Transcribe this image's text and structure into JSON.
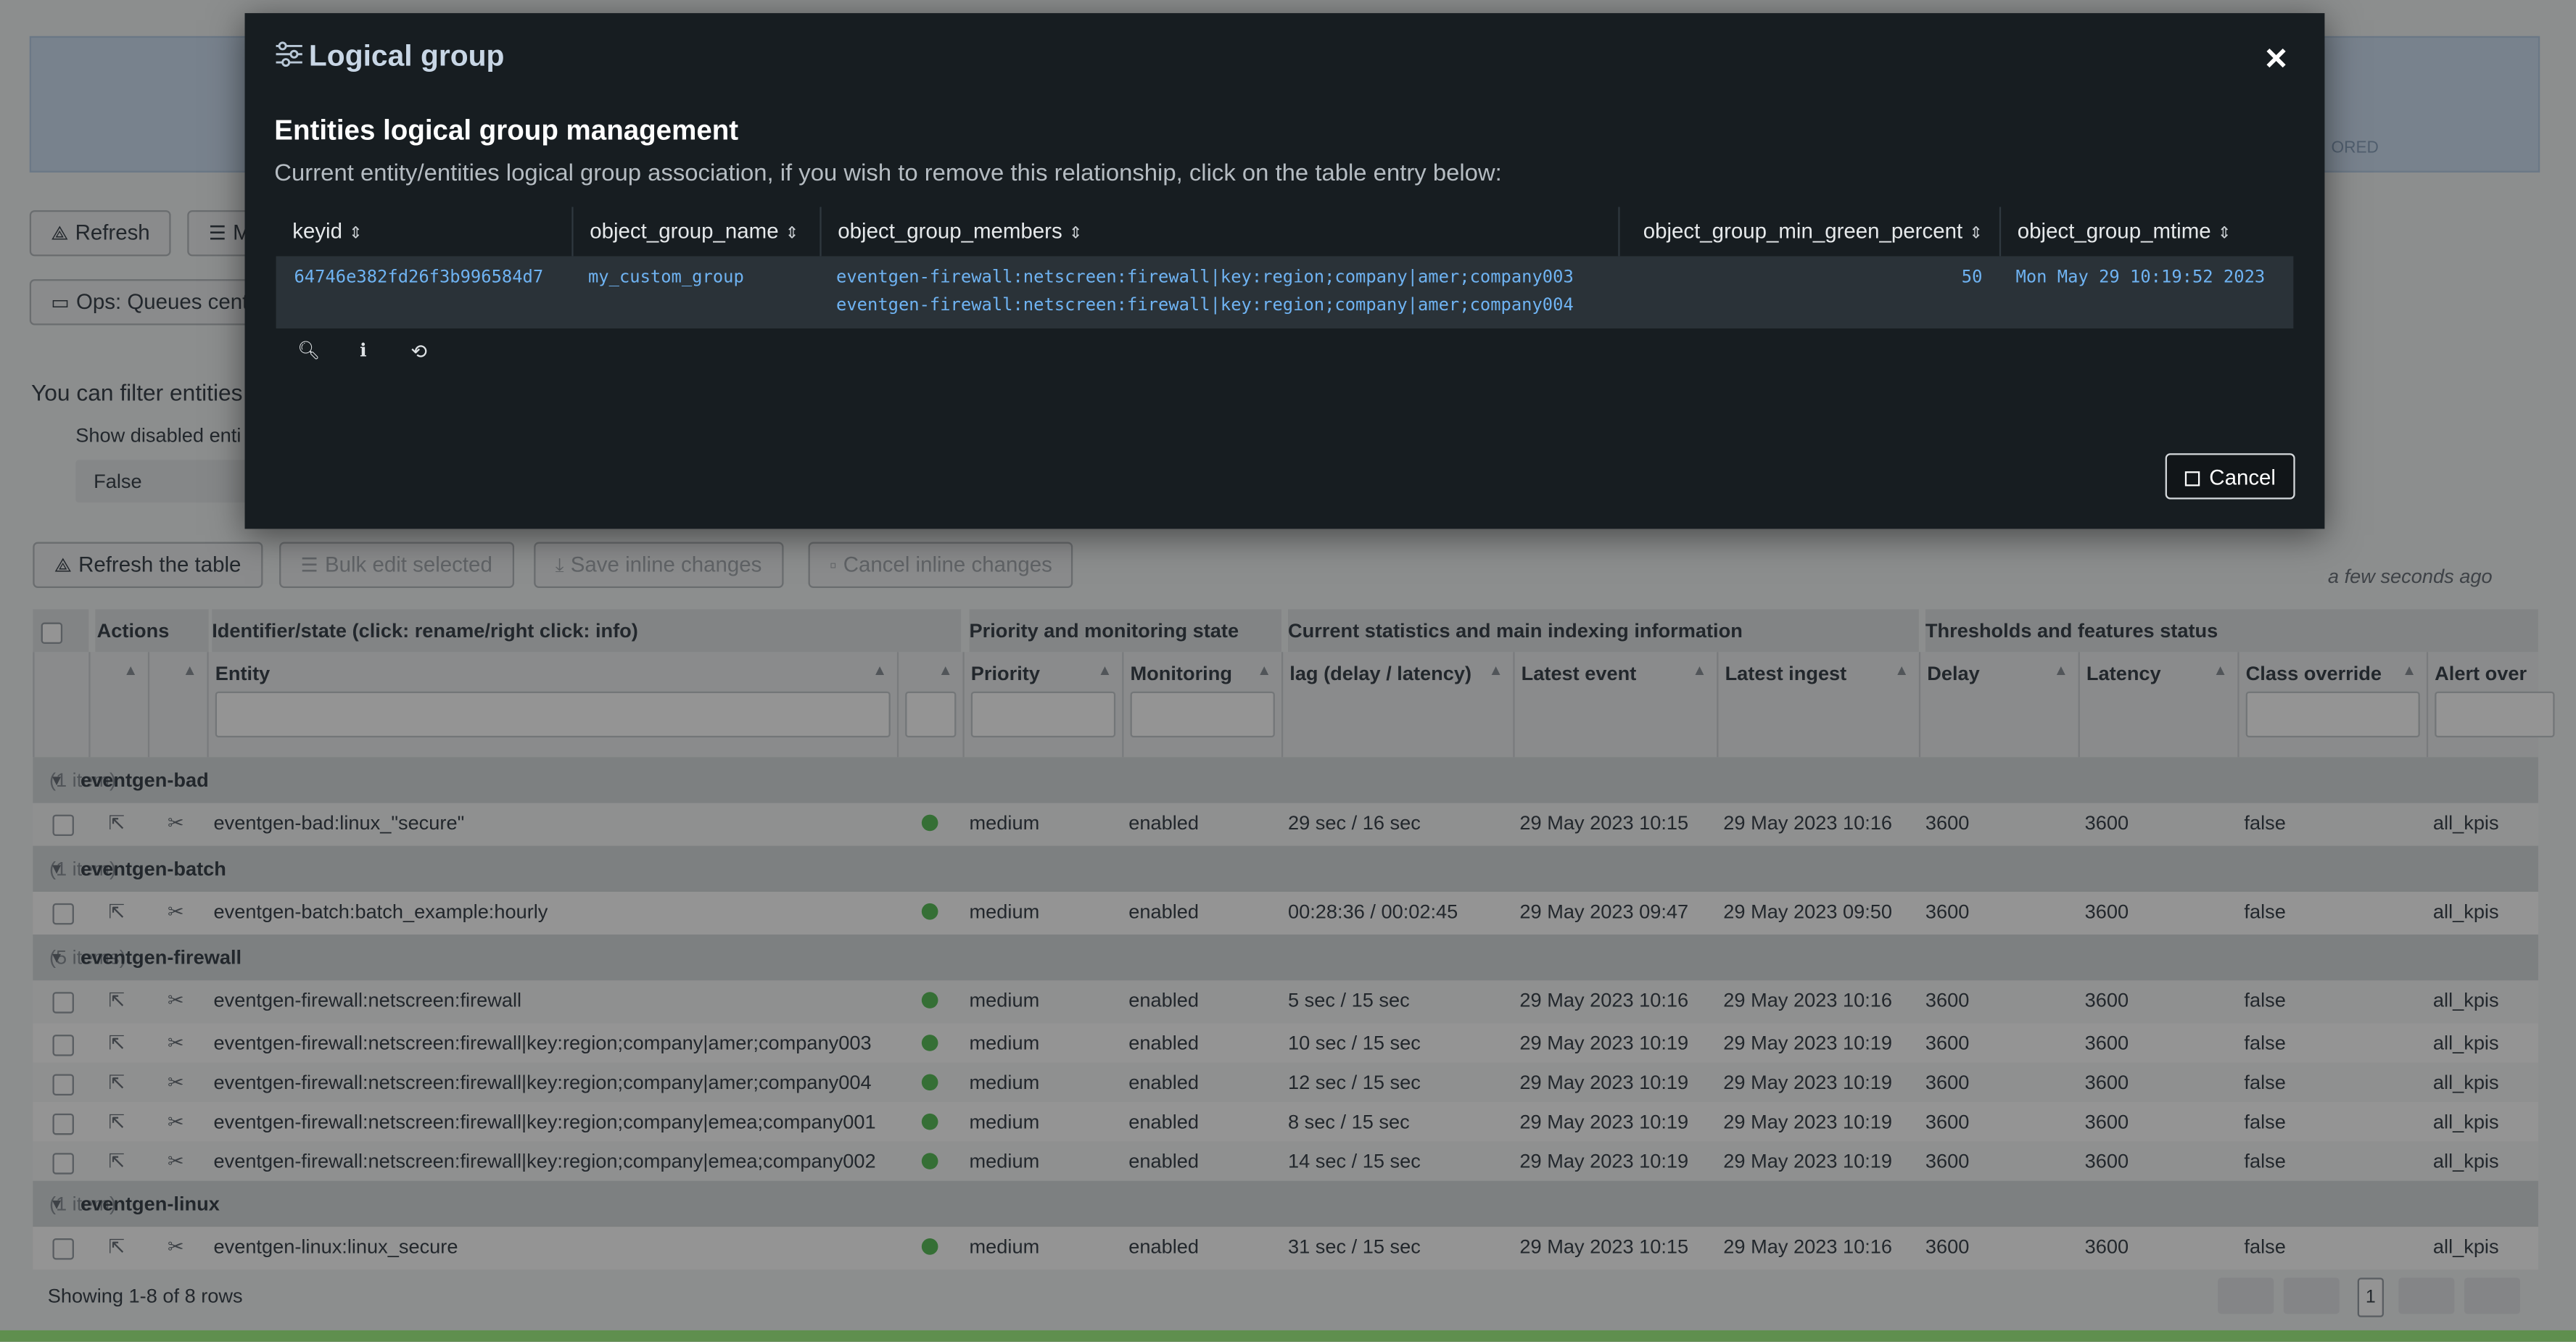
{
  "background": {
    "banner_fragment": "ORED",
    "refresh_label": "Refresh",
    "second_button_fragment": "M",
    "ops_button": "Ops: Queues cente",
    "filter_text": "You can filter entities",
    "show_disabled_label": "Show disabled enti",
    "show_disabled_value": "False",
    "toolbar": {
      "refresh_table": "Refresh the table",
      "bulk_edit": "Bulk edit selected",
      "save_inline": "Save inline changes",
      "cancel_inline": "Cancel inline changes",
      "updated": "a few seconds ago"
    },
    "table": {
      "group_headers": [
        "Actions",
        "Identifier/state (click: rename/right click: info)",
        "Priority and monitoring state",
        "Current statistics and main indexing information",
        "Thresholds and features status"
      ],
      "columns": [
        "Entity",
        "Priority",
        "Monitoring",
        "lag (delay / latency)",
        "Latest event",
        "Latest ingest",
        "Delay",
        "Latency",
        "Class override",
        "Alert over"
      ],
      "groups": [
        {
          "name": "eventgen-bad",
          "count": "(1 item)",
          "rows": [
            {
              "entity": "eventgen-bad:linux_\"secure\"",
              "priority": "medium",
              "monitoring": "enabled",
              "lag": "29 sec / 16 sec",
              "latest_event": "29 May 2023 10:15",
              "latest_ingest": "29 May 2023 10:16",
              "delay": "3600",
              "latency": "3600",
              "class_override": "false",
              "alert": "all_kpis"
            }
          ]
        },
        {
          "name": "eventgen-batch",
          "count": "(1 item)",
          "rows": [
            {
              "entity": "eventgen-batch:batch_example:hourly",
              "priority": "medium",
              "monitoring": "enabled",
              "lag": "00:28:36 / 00:02:45",
              "latest_event": "29 May 2023 09:47",
              "latest_ingest": "29 May 2023 09:50",
              "delay": "3600",
              "latency": "3600",
              "class_override": "false",
              "alert": "all_kpis"
            }
          ]
        },
        {
          "name": "eventgen-firewall",
          "count": "(5 items)",
          "rows": [
            {
              "entity": "eventgen-firewall:netscreen:firewall",
              "priority": "medium",
              "monitoring": "enabled",
              "lag": "5 sec / 15 sec",
              "latest_event": "29 May 2023 10:16",
              "latest_ingest": "29 May 2023 10:16",
              "delay": "3600",
              "latency": "3600",
              "class_override": "false",
              "alert": "all_kpis"
            },
            {
              "entity": "eventgen-firewall:netscreen:firewall|key:region;company|amer;company003",
              "priority": "medium",
              "monitoring": "enabled",
              "lag": "10 sec / 15 sec",
              "latest_event": "29 May 2023 10:19",
              "latest_ingest": "29 May 2023 10:19",
              "delay": "3600",
              "latency": "3600",
              "class_override": "false",
              "alert": "all_kpis"
            },
            {
              "entity": "eventgen-firewall:netscreen:firewall|key:region;company|amer;company004",
              "priority": "medium",
              "monitoring": "enabled",
              "lag": "12 sec / 15 sec",
              "latest_event": "29 May 2023 10:19",
              "latest_ingest": "29 May 2023 10:19",
              "delay": "3600",
              "latency": "3600",
              "class_override": "false",
              "alert": "all_kpis"
            },
            {
              "entity": "eventgen-firewall:netscreen:firewall|key:region;company|emea;company001",
              "priority": "medium",
              "monitoring": "enabled",
              "lag": "8 sec / 15 sec",
              "latest_event": "29 May 2023 10:19",
              "latest_ingest": "29 May 2023 10:19",
              "delay": "3600",
              "latency": "3600",
              "class_override": "false",
              "alert": "all_kpis"
            },
            {
              "entity": "eventgen-firewall:netscreen:firewall|key:region;company|emea;company002",
              "priority": "medium",
              "monitoring": "enabled",
              "lag": "14 sec / 15 sec",
              "latest_event": "29 May 2023 10:19",
              "latest_ingest": "29 May 2023 10:19",
              "delay": "3600",
              "latency": "3600",
              "class_override": "false",
              "alert": "all_kpis"
            }
          ]
        },
        {
          "name": "eventgen-linux",
          "count": "(1 item)",
          "rows": [
            {
              "entity": "eventgen-linux:linux_secure",
              "priority": "medium",
              "monitoring": "enabled",
              "lag": "31 sec / 15 sec",
              "latest_event": "29 May 2023 10:15",
              "latest_ingest": "29 May 2023 10:16",
              "delay": "3600",
              "latency": "3600",
              "class_override": "false",
              "alert": "all_kpis"
            }
          ]
        }
      ],
      "showing": "Showing 1-8 of 8 rows",
      "current_page": "1"
    }
  },
  "modal": {
    "title": "Logical group",
    "heading": "Entities logical group management",
    "description": "Current entity/entities logical group association, if you wish to remove this relationship, click on the table entry below:",
    "columns": [
      "keyid",
      "object_group_name",
      "object_group_members",
      "object_group_min_green_percent",
      "object_group_mtime"
    ],
    "row": {
      "keyid": "64746e382fd26f3b996584d7",
      "group_name": "my_custom_group",
      "members": [
        "eventgen-firewall:netscreen:firewall|key:region;company|amer;company003",
        "eventgen-firewall:netscreen:firewall|key:region;company|amer;company004"
      ],
      "min_green_percent": "50",
      "mtime": "Mon May 29 10:19:52 2023"
    },
    "cancel_label": "Cancel"
  }
}
